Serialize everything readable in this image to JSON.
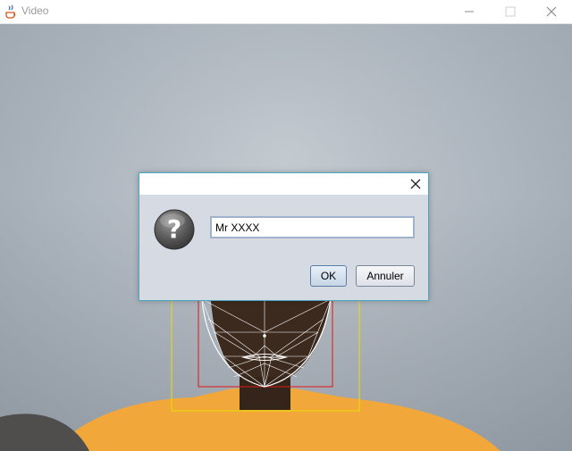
{
  "window": {
    "title": "Video",
    "icon": "java-cup-icon",
    "controls": [
      "minimize-icon",
      "maximize-icon",
      "close-icon"
    ]
  },
  "dialog": {
    "icon": "question-icon",
    "input_value": "Mr XXXX",
    "ok_label": "OK",
    "cancel_label": "Annuler",
    "close_icon": "close-icon"
  },
  "overlay": {
    "face_box_color": "#e01818",
    "outer_box_color": "#e8e000",
    "mesh_color": "#ffffff"
  }
}
